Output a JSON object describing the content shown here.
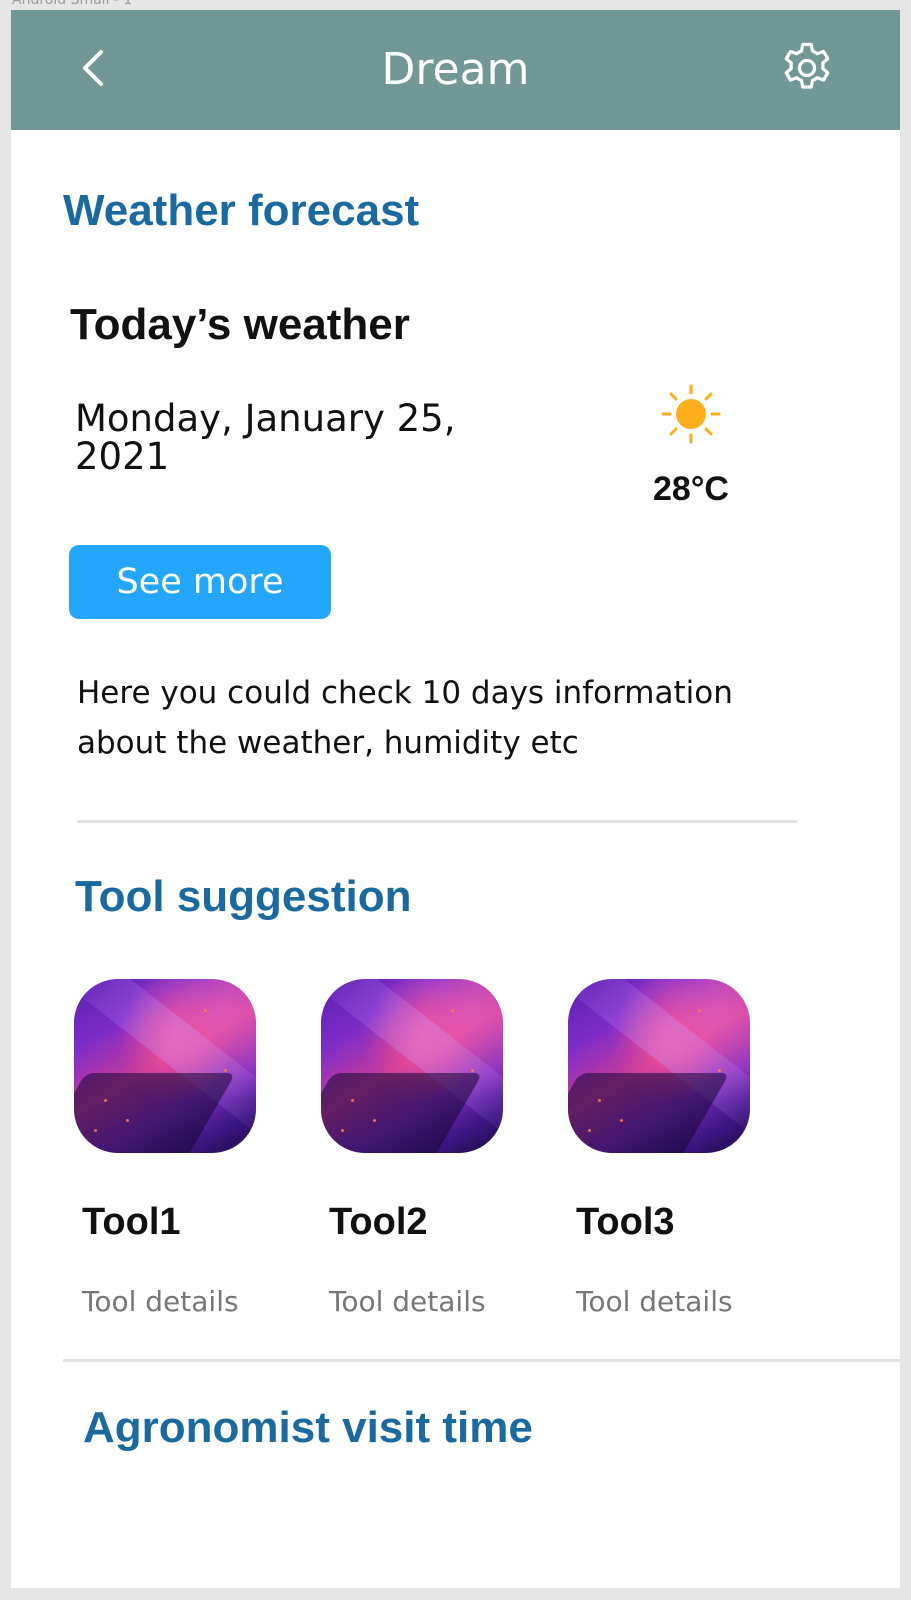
{
  "frame": {
    "label": "Android Small - 1"
  },
  "appbar": {
    "title": "Dream",
    "back_icon": "chevron-left-icon",
    "settings_icon": "gear-icon",
    "background": "#719896"
  },
  "weather": {
    "section_title": "Weather forecast",
    "today_heading": "Today’s weather",
    "date_line1": "Monday, January 25,",
    "date_line2": "2021",
    "condition_icon": "sun-icon",
    "temperature": "28°C",
    "see_more_label": "See more",
    "info_line1": "Here you could check 10 days information",
    "info_line2": "about the weather, humidity etc"
  },
  "tools": {
    "section_title": "Tool suggestion",
    "items": [
      {
        "name": "Tool1",
        "details": "Tool details"
      },
      {
        "name": "Tool2",
        "details": "Tool details"
      },
      {
        "name": "Tool3",
        "details": "Tool details"
      }
    ]
  },
  "agronomist": {
    "section_title": "Agronomist visit time"
  },
  "colors": {
    "accent": "#1a6aa0",
    "button": "#23a6fb",
    "sun": "#fcae1e"
  }
}
